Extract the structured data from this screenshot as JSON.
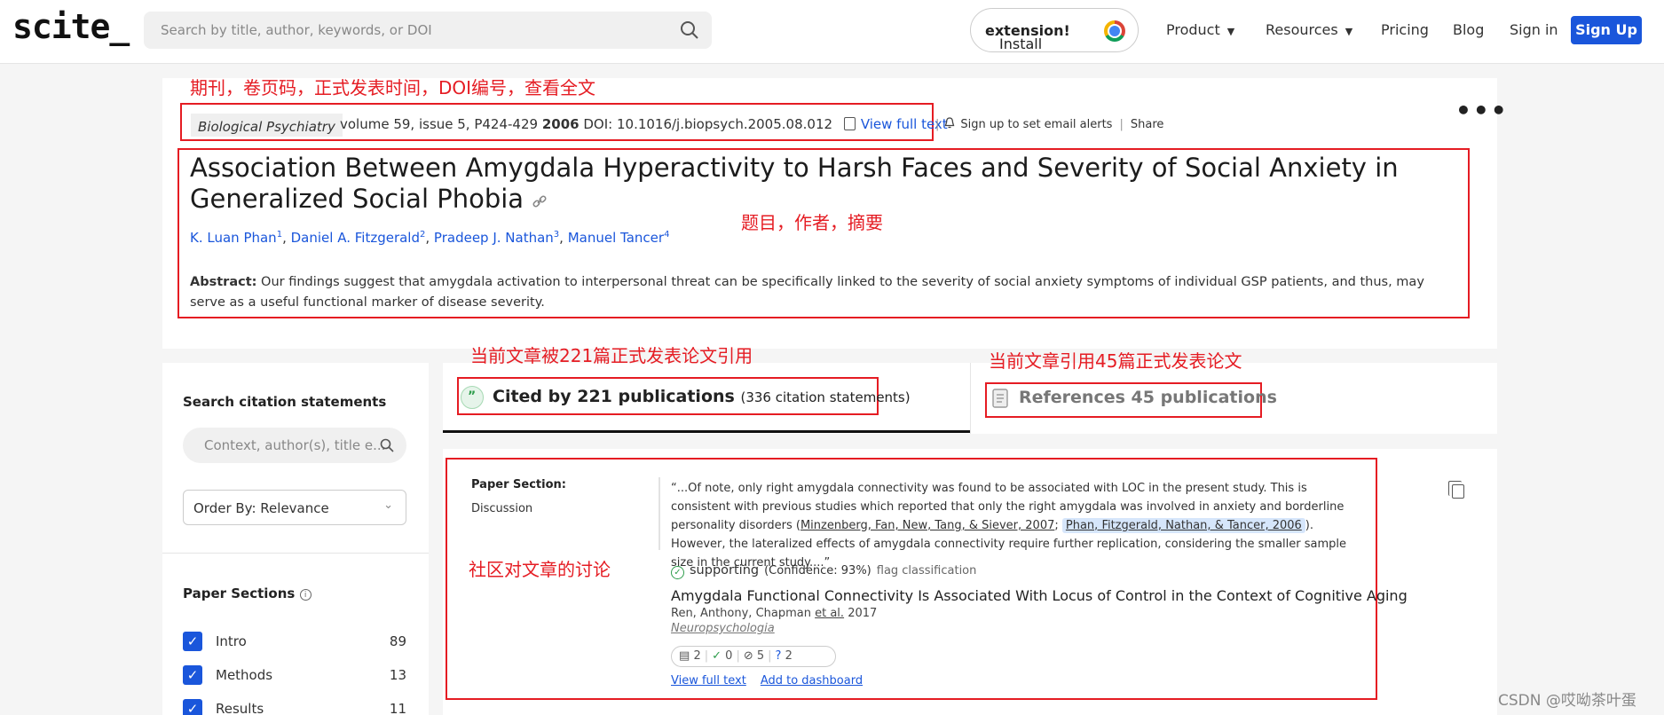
{
  "header": {
    "logo": "scite_",
    "search_placeholder": "Search by title, author, keywords, or DOI",
    "install_prefix": "Install ",
    "install_bold": "extension!",
    "nav": [
      "Product",
      "Resources",
      "Pricing",
      "Blog",
      "Sign in"
    ],
    "signup": "Sign Up"
  },
  "annotations": {
    "meta": "期刊，卷页码，正式发表时间，DOI编号，查看全文",
    "title": "题目，作者，摘要",
    "cited": "当前文章被221篇正式发表论文引用",
    "references": "当前文章引用45篇正式发表论文",
    "discussion": "社区对文章的讨论"
  },
  "paper": {
    "journal": "Biological Psychiatry",
    "volume": "volume 59, issue 5, P424-429",
    "year": "2006",
    "doi": "DOI: 10.1016/j.biopsych.2005.08.012",
    "view_full_text": "View full text",
    "email_alerts": "Sign up to set email alerts",
    "share": "Share",
    "title": "Association Between Amygdala Hyperactivity to Harsh Faces and Severity of Social Anxiety in Generalized Social Phobia",
    "authors": [
      {
        "name": "K. Luan Phan",
        "sup": "1"
      },
      {
        "name": "Daniel A. Fitzgerald",
        "sup": "2"
      },
      {
        "name": "Pradeep J. Nathan",
        "sup": "3"
      },
      {
        "name": "Manuel Tancer",
        "sup": "4"
      }
    ],
    "abstract_label": "Abstract:",
    "abstract": "Our findings suggest that amygdala activation to interpersonal threat can be specifically linked to the severity of social anxiety symptoms of individual GSP patients, and thus, may serve as a useful functional marker of disease severity."
  },
  "sidebar": {
    "search_title": "Search citation statements",
    "search_placeholder": "Context, author(s), title e...",
    "order_by": "Order By: Relevance",
    "sections_title": "Paper Sections",
    "sections": [
      {
        "label": "Intro",
        "count": "89"
      },
      {
        "label": "Methods",
        "count": "13"
      },
      {
        "label": "Results",
        "count": "11"
      }
    ]
  },
  "tabs": {
    "cited_bold": "Cited by 221 publications",
    "cited_sub": "(336 citation statements)",
    "references": "References 45 publications"
  },
  "citation": {
    "section_label": "Paper Section:",
    "section_value": "Discussion",
    "quote_1": "“...Of note, only right amygdala connectivity was found to be associated with LOC in the present study. This is consistent with previous studies which reported that only the right amygdala was involved in anxiety and borderline personality disorders (",
    "ref_1": "Minzenberg, Fan, New, Tang, & Siever, 2007",
    "quote_2": "; ",
    "ref_2": "Phan, Fitzgerald, Nathan, & Tancer, 2006",
    "quote_3": "). However, the lateralized effects of amygdala connectivity require further replication, considering the smaller sample size in the current study....”",
    "stance": "supporting",
    "confidence": "(Confidence: 93%)",
    "flag": "flag classification",
    "paper_title": "Amygdala Functional Connectivity Is Associated With Locus of Control in the Context of Cognitive Aging",
    "paper_authors": "Ren, Anthony, Chapman ",
    "et_al": "et al.",
    "paper_year": "2017",
    "paper_journal": "Neuropsychologia",
    "badge_counts": [
      "2",
      "0",
      "5",
      "2"
    ],
    "view_full_text": "View full text",
    "add_dashboard": "Add to dashboard"
  },
  "watermark": "CSDN @哎呦茶叶蛋",
  "colors": {
    "annotation": "#e51c23",
    "link": "#1a56db",
    "brand_button": "#1a56db",
    "supporting": "#2e9d4c"
  }
}
